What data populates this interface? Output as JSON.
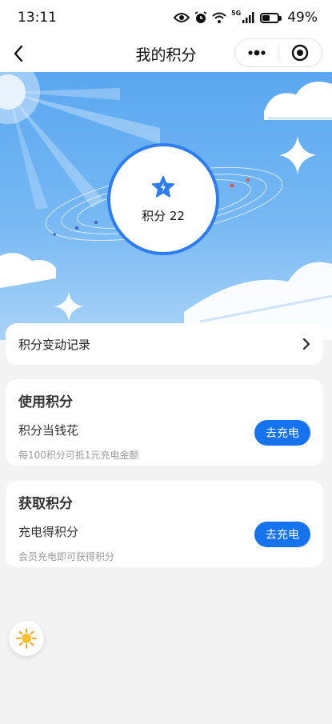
{
  "status": {
    "time": "13:11",
    "battery": "49%",
    "signal": "5G"
  },
  "nav": {
    "title": "我的积分"
  },
  "hero": {
    "points_text": "积分 22"
  },
  "record": {
    "label": "积分变动记录"
  },
  "use_section": {
    "title": "使用积分",
    "subtitle": "积分当钱花",
    "description": "每100积分可抵1元充电金额",
    "button": "去充电"
  },
  "earn_section": {
    "title": "获取积分",
    "subtitle": "充电得积分",
    "description": "会员充电即可获得积分",
    "button": "去充电"
  },
  "colors": {
    "primary": "#1673f0",
    "circle_border": "#2e7df0",
    "sky": "#5aa7f0"
  }
}
